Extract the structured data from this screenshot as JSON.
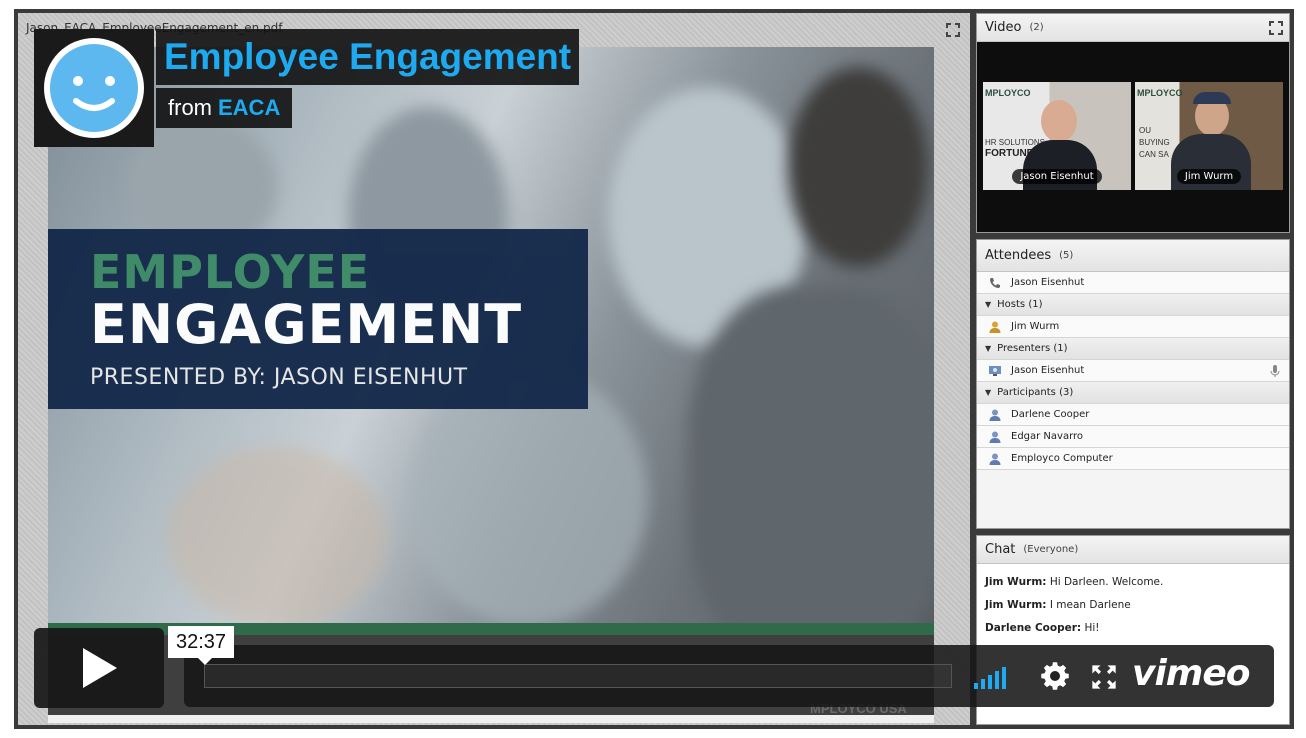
{
  "share": {
    "file_name": "Jason_EACA_EmployeeEngagement_en.pdf",
    "slide_line1": "EMPLOYEE",
    "slide_line2": "ENGAGEMENT",
    "slide_line3": "PRESENTED BY: JASON EISENHUT",
    "slide_logo": "MPLOYCO USA"
  },
  "video_pod": {
    "title": "Video",
    "count": "(2)",
    "cams": [
      {
        "name": "Jason Eisenhut",
        "sign1": "MPLOYCO",
        "sign2": "HR SOLUTIONS",
        "sign3": "FORTUNE"
      },
      {
        "name": "Jim Wurm",
        "sign1": "MPLOYCO",
        "sign2": "OU",
        "sign3": "BUYING",
        "sign4": "CAN SA"
      }
    ]
  },
  "attendees": {
    "title": "Attendees",
    "count": "(5)",
    "top_row": "Jason Eisenhut",
    "hosts_label": "Hosts (1)",
    "hosts": [
      "Jim Wurm"
    ],
    "presenters_label": "Presenters (1)",
    "presenters": [
      "Jason Eisenhut"
    ],
    "participants_label": "Participants (3)",
    "participants": [
      "Darlene Cooper",
      "Edgar Navarro",
      "Employco Computer"
    ]
  },
  "chat": {
    "title": "Chat",
    "scope": "(Everyone)",
    "messages": [
      {
        "sender": "Jim Wurm:",
        "text": " Hi Darleen.  Welcome."
      },
      {
        "sender": "Jim Wurm:",
        "text": " I mean Darlene"
      },
      {
        "sender": "Darlene Cooper:",
        "text": " Hi!"
      }
    ]
  },
  "video_badge": {
    "title": "Employee Engagement",
    "from_label": "from",
    "from_channel": "EACA"
  },
  "player": {
    "timecode": "32:37",
    "progress_fraction": 0.0,
    "brand": "vimeo",
    "accent_color": "#1eaaf1"
  }
}
